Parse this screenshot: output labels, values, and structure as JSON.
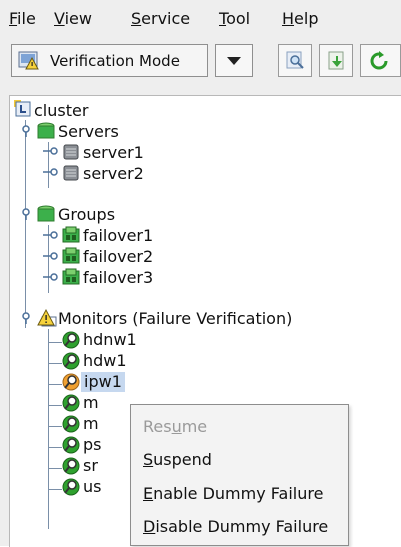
{
  "menubar": {
    "items": [
      {
        "pre": "",
        "key": "F",
        "post": "ile"
      },
      {
        "pre": "",
        "key": "V",
        "post": "iew"
      },
      {
        "pre": "",
        "key": "S",
        "post": "ervice"
      },
      {
        "pre": "",
        "key": "T",
        "post": "ool"
      },
      {
        "pre": "",
        "key": "H",
        "post": "elp"
      }
    ]
  },
  "toolbar": {
    "mode_label": "Verification Mode",
    "buttons": [
      "search-icon",
      "import-icon",
      "refresh-icon"
    ]
  },
  "tree": {
    "root": "cluster",
    "servers": {
      "label": "Servers",
      "items": [
        "server1",
        "server2"
      ]
    },
    "groups": {
      "label": "Groups",
      "items": [
        "failover1",
        "failover2",
        "failover3"
      ]
    },
    "monitors": {
      "label": "Monitors (Failure Verification)",
      "items": [
        "hdnw1",
        "hdw1",
        "ipw1",
        "m",
        "m",
        "ps",
        "sr",
        "us"
      ]
    },
    "selected": "ipw1"
  },
  "context_menu": {
    "items": [
      {
        "pre": "Res",
        "key": "u",
        "post": "me",
        "enabled": false
      },
      {
        "pre": "",
        "key": "S",
        "post": "uspend",
        "enabled": true
      },
      {
        "pre": "",
        "key": "E",
        "post": "nable Dummy Failure",
        "enabled": true
      },
      {
        "pre": "",
        "key": "D",
        "post": "isable Dummy Failure",
        "enabled": true
      }
    ]
  },
  "colors": {
    "monitor_ok": "#2ea12e",
    "monitor_warn": "#f0a030",
    "group_green": "#3cb04b",
    "selection": "#c6d8ef"
  }
}
